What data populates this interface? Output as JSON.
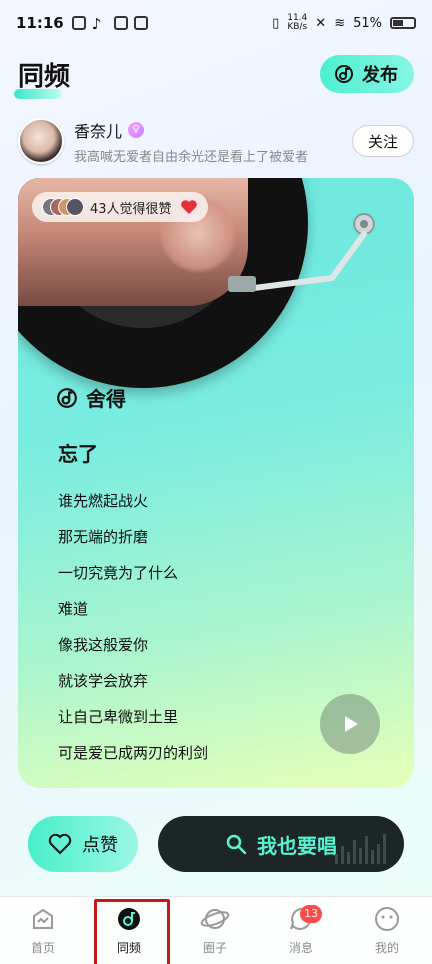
{
  "status_bar": {
    "time": "11:16",
    "network_speed": "11.4\nKB/s",
    "battery_percent": "51%"
  },
  "header": {
    "title": "同频",
    "publish_label": "发布"
  },
  "user": {
    "name": "香奈儿",
    "subtitle": "我高喊无爱者自由余光还是看上了被爱者",
    "follow_label": "关注"
  },
  "card": {
    "likes_text": "43人觉得很赞",
    "song_title": "舍得",
    "lyrics_first": "忘了",
    "lyrics": [
      "谁先燃起战火",
      "那无端的折磨",
      "一切究竟为了什么",
      "难道",
      "像我这般爱你",
      "就该学会放弃",
      "让自己卑微到土里",
      "可是爱已成两刃的利剑"
    ]
  },
  "actions": {
    "like_label": "点赞",
    "sing_label": "我也要唱"
  },
  "bottom_nav": {
    "items": [
      {
        "label": "首页",
        "icon": "home-icon"
      },
      {
        "label": "同频",
        "icon": "music-note-icon"
      },
      {
        "label": "圈子",
        "icon": "planet-icon"
      },
      {
        "label": "消息",
        "icon": "chat-icon",
        "badge": "13"
      },
      {
        "label": "我的",
        "icon": "profile-icon"
      }
    ]
  },
  "colors": {
    "accent": "#58f3d0",
    "card_gradient_start": "#6de7de",
    "card_gradient_end": "#e6ffb8",
    "sing_button_bg": "#1d2627",
    "badge_red": "#ff4a4a",
    "highlight_outline": "#c21a1a"
  }
}
